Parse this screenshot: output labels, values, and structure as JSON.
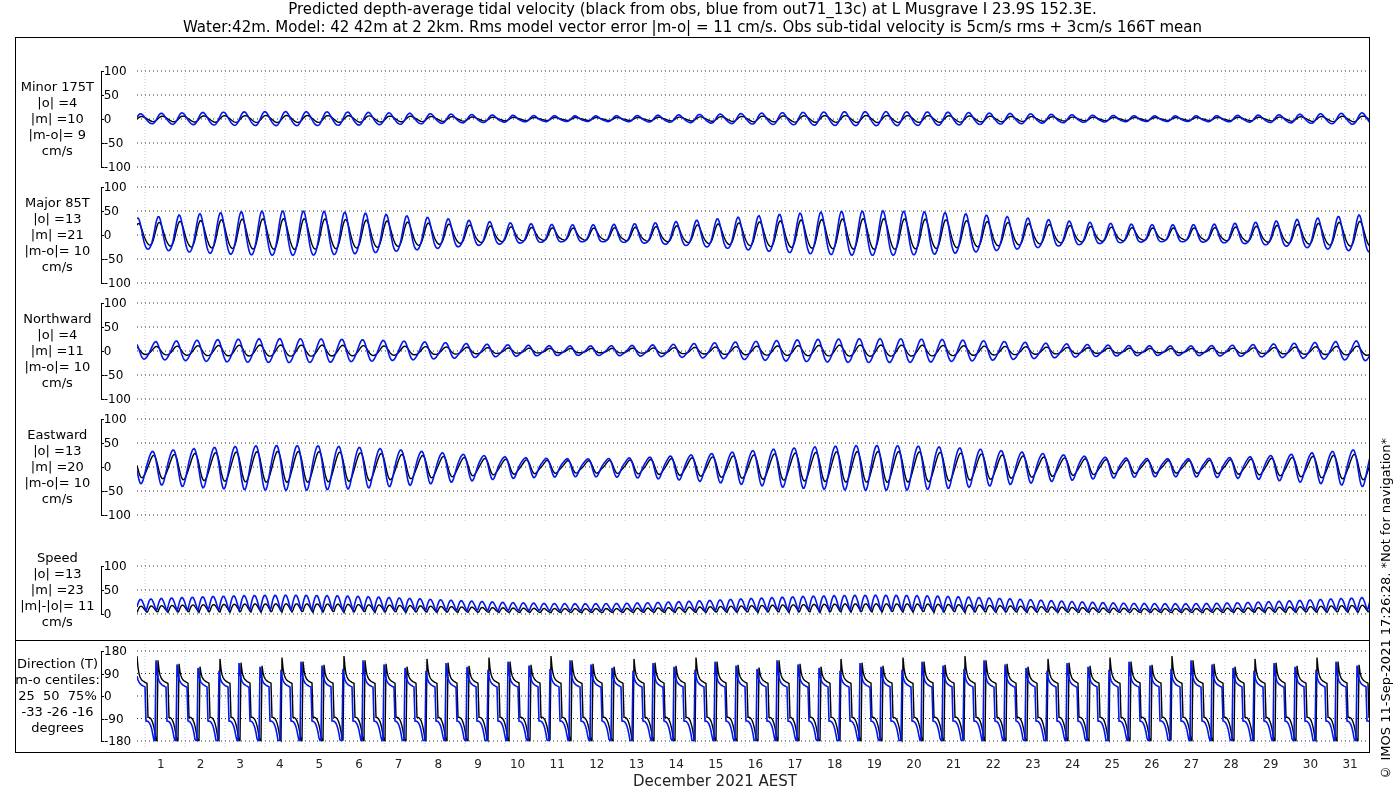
{
  "title": [
    "Predicted depth-average tidal velocity (black from obs, blue from out71_13c) at L Musgrave I 23.9S 152.3E.",
    "Water:42m. Model: 42 42m at 2 2km. Rms model vector error |m-o| = 11 cm/s. Obs sub-tidal velocity is 5cm/s rms + 3cm/s 166T mean"
  ],
  "panels": [
    {
      "kind": "velocity",
      "label": [
        "Minor 175T",
        "|o| =4",
        "|m| =10",
        "|m-o|= 9",
        "cm/s"
      ],
      "yticks": [
        "100",
        "50",
        "0",
        "-50",
        "-100"
      ]
    },
    {
      "kind": "velocity",
      "label": [
        "Major 85T",
        "|o| =13",
        "|m| =21",
        "|m-o|= 10",
        "cm/s"
      ],
      "yticks": [
        "100",
        "50",
        "0",
        "-50",
        "-100"
      ]
    },
    {
      "kind": "velocity",
      "label": [
        "Northward",
        "|o| =4",
        "|m| =11",
        "|m-o|= 10",
        "cm/s"
      ],
      "yticks": [
        "100",
        "50",
        "0",
        "-50",
        "-100"
      ]
    },
    {
      "kind": "velocity",
      "label": [
        "Eastward",
        "|o| =13",
        "|m| =20",
        "|m-o|= 10",
        "cm/s"
      ],
      "yticks": [
        "100",
        "50",
        "0",
        "-50",
        "-100"
      ]
    },
    {
      "kind": "speed",
      "label": [
        "Speed",
        "|o| =13",
        "|m| =23",
        "|m|-|o|= 11",
        "cm/s"
      ],
      "yticks": [
        "100",
        "50",
        "0"
      ]
    },
    {
      "kind": "direction",
      "label": [
        "Direction (T)",
        "m-o centiles:",
        "25  50  75%",
        "-33 -26 -16",
        "degrees"
      ],
      "yticks": [
        "180",
        "90",
        "0",
        "-90",
        "-180"
      ]
    }
  ],
  "x_axis": {
    "ticks": [
      "1",
      "2",
      "3",
      "4",
      "5",
      "6",
      "7",
      "8",
      "9",
      "10",
      "11",
      "12",
      "13",
      "14",
      "15",
      "16",
      "17",
      "18",
      "19",
      "20",
      "21",
      "22",
      "23",
      "24",
      "25",
      "26",
      "27",
      "28",
      "29",
      "30",
      "31"
    ],
    "label": "December 2021 AEST"
  },
  "credit": "© IMOS 11-Sep-2021 17:26:28. *Not for navigation*"
}
